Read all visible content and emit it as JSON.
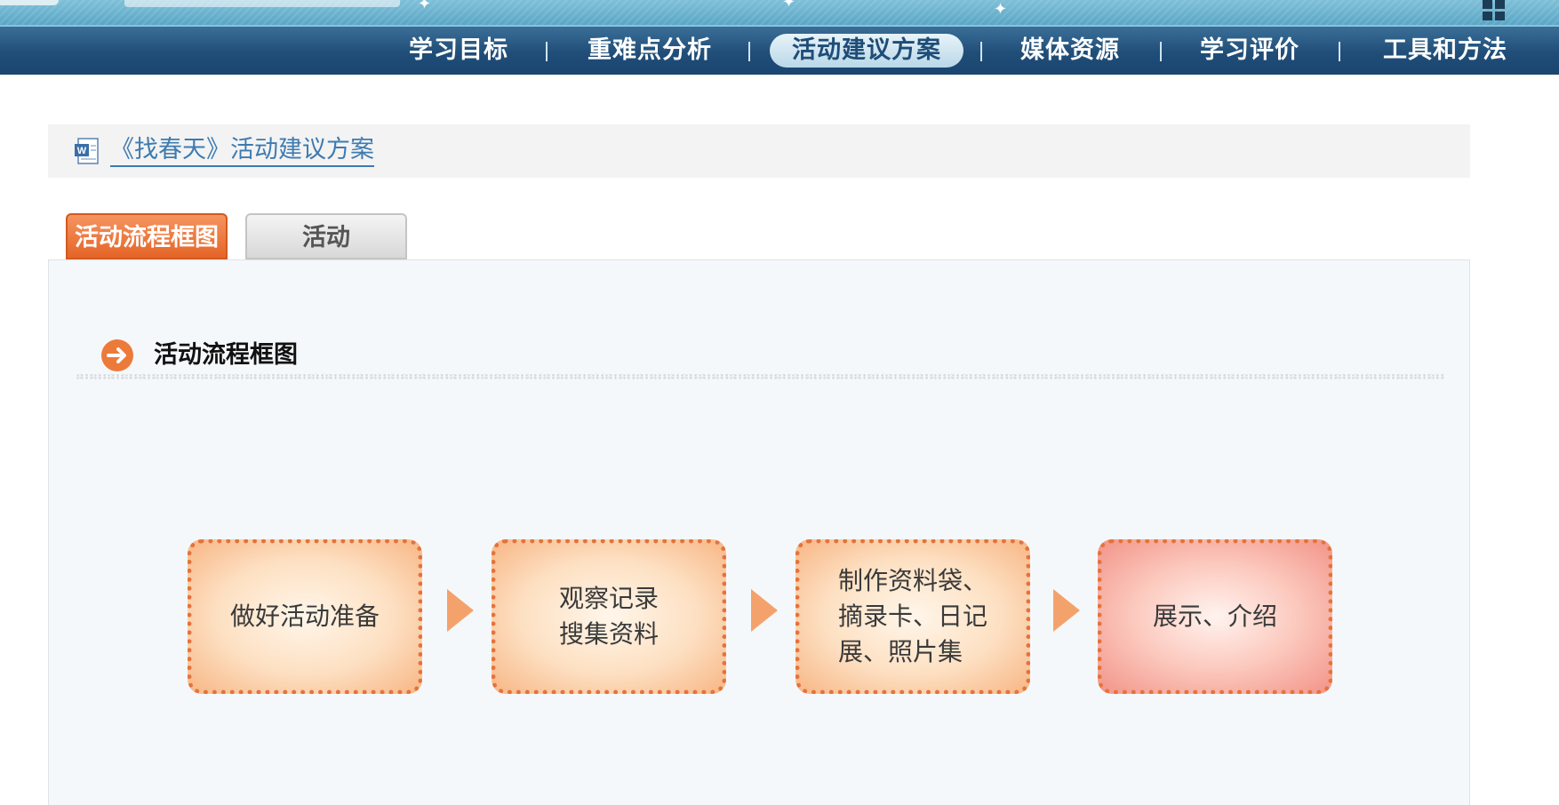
{
  "nav": {
    "items": [
      "学习目标",
      "重难点分析",
      "活动建议方案",
      "媒体资源",
      "学习评价",
      "工具和方法"
    ],
    "active": "活动建议方案"
  },
  "doc": {
    "title": "《找春天》活动建议方案"
  },
  "tabs": {
    "active_label": "活动流程框图",
    "inactive_label": "活动"
  },
  "section": {
    "title": "活动流程框图"
  },
  "flow": {
    "steps": [
      "做好活动准备",
      "观察记录\n搜集资料",
      "制作资料袋、\n摘录卡、日记\n展、照片集",
      "展示、介绍"
    ]
  },
  "colors": {
    "nav_bg": "#204e78",
    "tab_active": "#e56427",
    "flow_border": "#e5733a",
    "flow_fill": "#fde0c2",
    "flow_fill_last": "#fccabf",
    "arrow": "#f4a26c",
    "link": "#3e7bb0"
  }
}
